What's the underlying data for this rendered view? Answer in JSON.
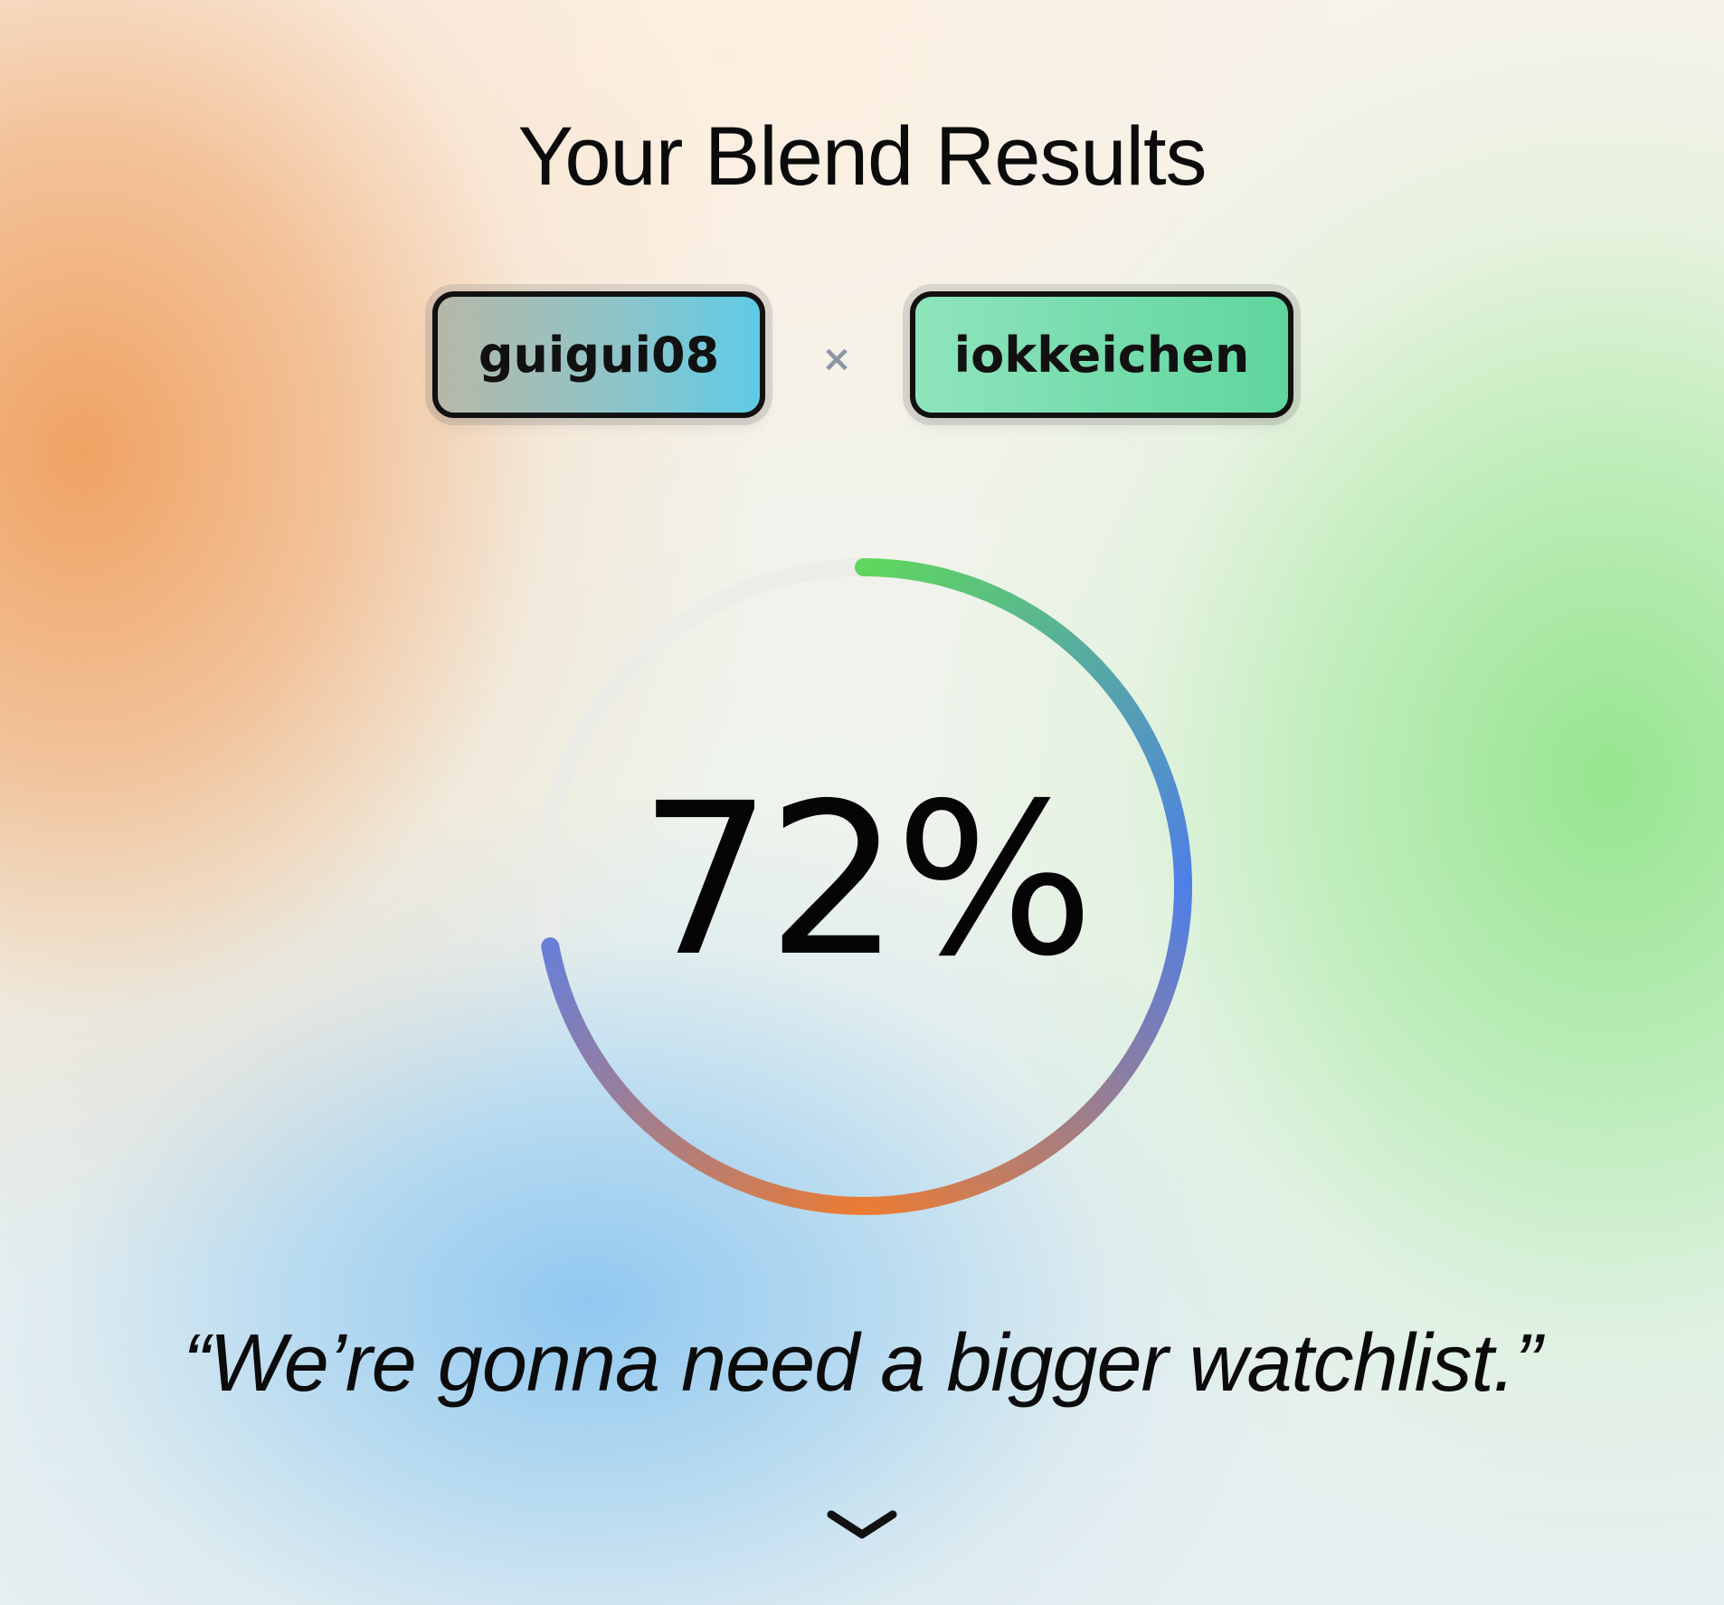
{
  "page": {
    "title": "Your Blend Results"
  },
  "users": {
    "left": "guigui08",
    "separator": "×",
    "right": "iokkeichen"
  },
  "score": {
    "value": 72,
    "label": "72%"
  },
  "quote": "“We’re gonna need a bigger watchlist.”",
  "icons": {
    "expand": "chevron-down-icon"
  },
  "colors": {
    "ring_start": "#5fd65e",
    "ring_mid": "#4f7fe6",
    "ring_end": "#ea7c34",
    "ring_track": "#e8e8e6",
    "chip_border": "#111111"
  }
}
